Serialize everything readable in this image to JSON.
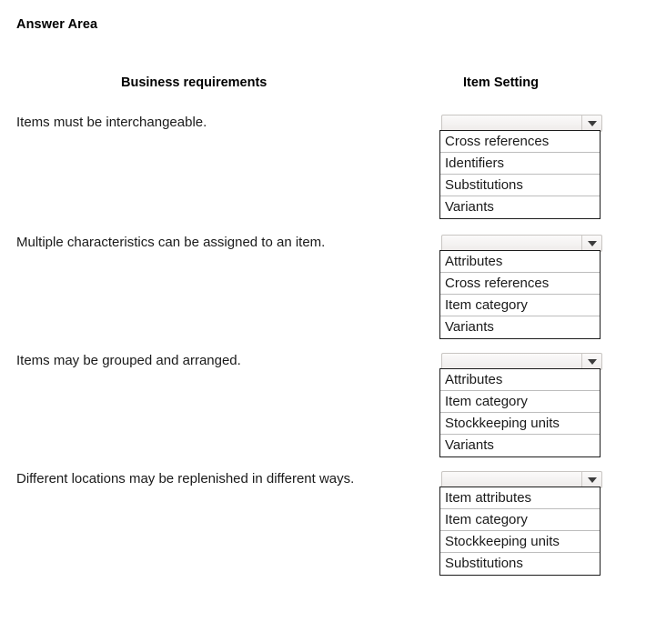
{
  "page": {
    "title": "Answer Area"
  },
  "headers": {
    "left": "Business requirements",
    "right": "Item Setting"
  },
  "colors": {
    "text": "#1a1a1a",
    "list_border": "#1c1c1c",
    "option_divider": "#bdbdbd",
    "button_border": "#c8c5c2",
    "arrow": "#3c3c3c",
    "background": "#ffffff"
  },
  "rows": [
    {
      "requirement": "Items must be interchangeable.",
      "dropdown": {
        "selected": "",
        "placeholder": "",
        "arrow_icon": "chevron-down-icon",
        "options": [
          "Cross references",
          "Identifiers",
          "Substitutions",
          "Variants"
        ]
      }
    },
    {
      "requirement": "Multiple characteristics can be assigned to an item.",
      "dropdown": {
        "selected": "",
        "placeholder": "",
        "arrow_icon": "chevron-down-icon",
        "options": [
          "Attributes",
          "Cross references",
          "Item category",
          "Variants"
        ]
      }
    },
    {
      "requirement": "Items may be grouped and arranged.",
      "dropdown": {
        "selected": "",
        "placeholder": "",
        "arrow_icon": "chevron-down-icon",
        "options": [
          "Attributes",
          "Item category",
          "Stockkeeping units",
          "Variants"
        ]
      }
    },
    {
      "requirement": "Different locations may be replenished in different ways.",
      "dropdown": {
        "selected": "",
        "placeholder": "",
        "arrow_icon": "chevron-down-icon",
        "options": [
          "Item attributes",
          "Item category",
          "Stockkeeping units",
          "Substitutions"
        ]
      }
    }
  ]
}
